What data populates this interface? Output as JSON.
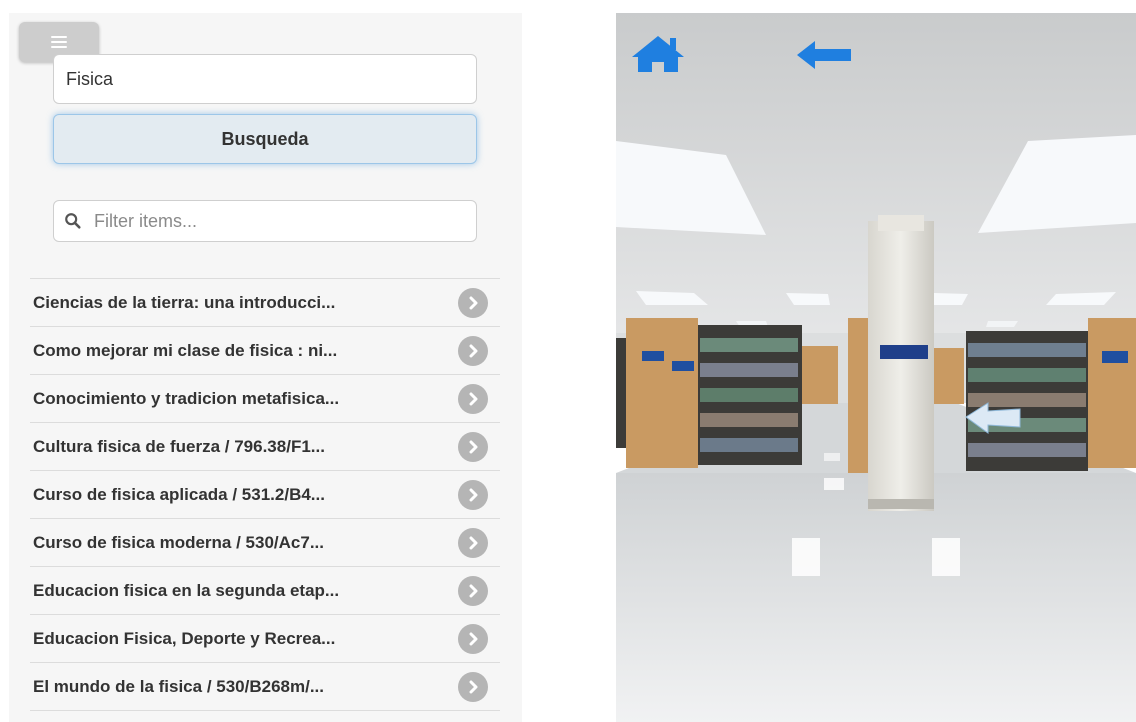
{
  "search": {
    "value": "Fisica",
    "button_label": "Busqueda"
  },
  "filter": {
    "placeholder": "Filter items..."
  },
  "results": [
    "Ciencias de la tierra: una introducci...",
    "Como mejorar mi clase de fisica : ni...",
    "Conocimiento y tradicion metafisica...",
    "Cultura fisica de fuerza / 796.38/F1...",
    "Curso de fisica aplicada / 531.2/B4...",
    "Curso de fisica moderna / 530/Ac7...",
    "Educacion fisica en la segunda etap...",
    "Educacion Fisica, Deporte y Recrea...",
    "El mundo de la fisica / 530/B268m/..."
  ],
  "icons": {
    "menu": "hamburger-icon",
    "filter": "search-icon",
    "row": "chevron-right-icon",
    "home": "home-icon",
    "back": "arrow-left-icon",
    "floor_nav": "arrow-left-icon"
  },
  "colors": {
    "accent_blue": "#1f7fe0",
    "button_bg": "#e3ebf1",
    "chevron_bg": "#b5b5b5",
    "list_bg": "#f6f6f6"
  }
}
